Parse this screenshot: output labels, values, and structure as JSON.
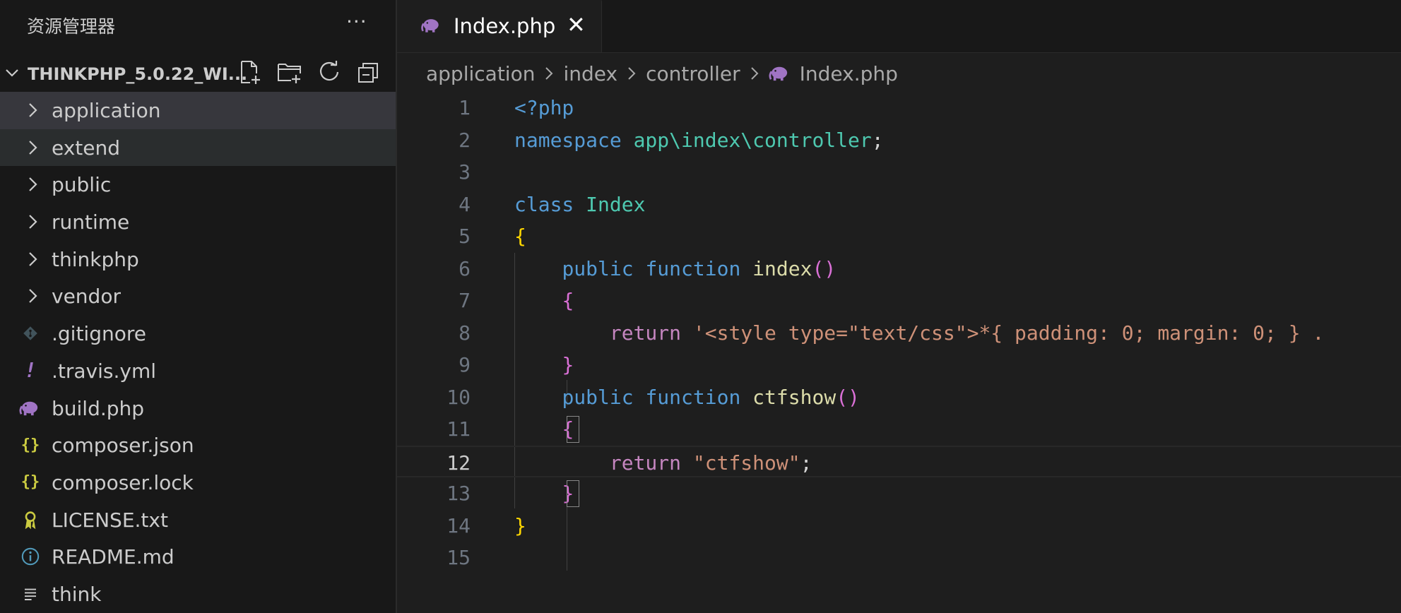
{
  "sidebar": {
    "title": "资源管理器",
    "more": "···",
    "project": "THINKPHP_5.0.22_WI...",
    "items": [
      {
        "label": "application",
        "type": "folder",
        "icon": "chevron-right-icon"
      },
      {
        "label": "extend",
        "type": "folder",
        "icon": "chevron-right-icon"
      },
      {
        "label": "public",
        "type": "folder",
        "icon": "chevron-right-icon"
      },
      {
        "label": "runtime",
        "type": "folder",
        "icon": "chevron-right-icon"
      },
      {
        "label": "thinkphp",
        "type": "folder",
        "icon": "chevron-right-icon"
      },
      {
        "label": "vendor",
        "type": "folder",
        "icon": "chevron-right-icon"
      },
      {
        "label": ".gitignore",
        "type": "file",
        "icon": "git-icon"
      },
      {
        "label": ".travis.yml",
        "type": "file",
        "icon": "yaml-icon",
        "glyph": "!"
      },
      {
        "label": "build.php",
        "type": "file",
        "icon": "php-elephant-icon"
      },
      {
        "label": "composer.json",
        "type": "file",
        "icon": "json-icon",
        "glyph": "{}"
      },
      {
        "label": "composer.lock",
        "type": "file",
        "icon": "json-icon",
        "glyph": "{}"
      },
      {
        "label": "LICENSE.txt",
        "type": "file",
        "icon": "license-icon"
      },
      {
        "label": "README.md",
        "type": "file",
        "icon": "info-icon"
      },
      {
        "label": "think",
        "type": "file",
        "icon": "text-lines-icon"
      }
    ]
  },
  "tab": {
    "label": "Index.php",
    "close": "✕"
  },
  "breadcrumb": [
    "application",
    "index",
    "controller",
    "Index.php"
  ],
  "editor": {
    "line_numbers": [
      "1",
      "2",
      "3",
      "4",
      "5",
      "6",
      "7",
      "8",
      "9",
      "10",
      "11",
      "12",
      "13",
      "14",
      "15"
    ],
    "current_line": "12",
    "lines": [
      [
        {
          "t": "<?php",
          "c": "kw"
        }
      ],
      [
        {
          "t": "namespace",
          "c": "kw"
        },
        {
          "t": " ",
          "c": "plain"
        },
        {
          "t": "app\\index\\controller",
          "c": "cls"
        },
        {
          "t": ";",
          "c": "plain"
        }
      ],
      [],
      [
        {
          "t": "class",
          "c": "kw"
        },
        {
          "t": " ",
          "c": "plain"
        },
        {
          "t": "Index",
          "c": "cls"
        }
      ],
      [
        {
          "t": "{",
          "c": "br1"
        }
      ],
      [
        {
          "t": "    ",
          "c": "plain"
        },
        {
          "t": "public",
          "c": "kw"
        },
        {
          "t": " ",
          "c": "plain"
        },
        {
          "t": "function",
          "c": "kw"
        },
        {
          "t": " ",
          "c": "plain"
        },
        {
          "t": "index",
          "c": "fn"
        },
        {
          "t": "()",
          "c": "br2"
        }
      ],
      [
        {
          "t": "    ",
          "c": "plain"
        },
        {
          "t": "{",
          "c": "br2"
        }
      ],
      [
        {
          "t": "        ",
          "c": "plain"
        },
        {
          "t": "return",
          "c": "ctl"
        },
        {
          "t": " ",
          "c": "plain"
        },
        {
          "t": "'<style type=\"text/css\">*{ padding: 0; margin: 0; } .",
          "c": "str"
        }
      ],
      [
        {
          "t": "    ",
          "c": "plain"
        },
        {
          "t": "}",
          "c": "br2"
        }
      ],
      [
        {
          "t": "    ",
          "c": "plain"
        },
        {
          "t": "public",
          "c": "kw"
        },
        {
          "t": " ",
          "c": "plain"
        },
        {
          "t": "function",
          "c": "kw"
        },
        {
          "t": " ",
          "c": "plain"
        },
        {
          "t": "ctfshow",
          "c": "fn"
        },
        {
          "t": "()",
          "c": "br2"
        }
      ],
      [
        {
          "t": "    ",
          "c": "plain"
        },
        {
          "t": "{",
          "c": "br2"
        }
      ],
      [
        {
          "t": "        ",
          "c": "plain"
        },
        {
          "t": "return",
          "c": "ctl"
        },
        {
          "t": " ",
          "c": "plain"
        },
        {
          "t": "\"ctfshow\"",
          "c": "str"
        },
        {
          "t": ";",
          "c": "plain"
        }
      ],
      [
        {
          "t": "    ",
          "c": "plain"
        },
        {
          "t": "}",
          "c": "br2"
        }
      ],
      [
        {
          "t": "}",
          "c": "br1"
        }
      ],
      []
    ]
  }
}
